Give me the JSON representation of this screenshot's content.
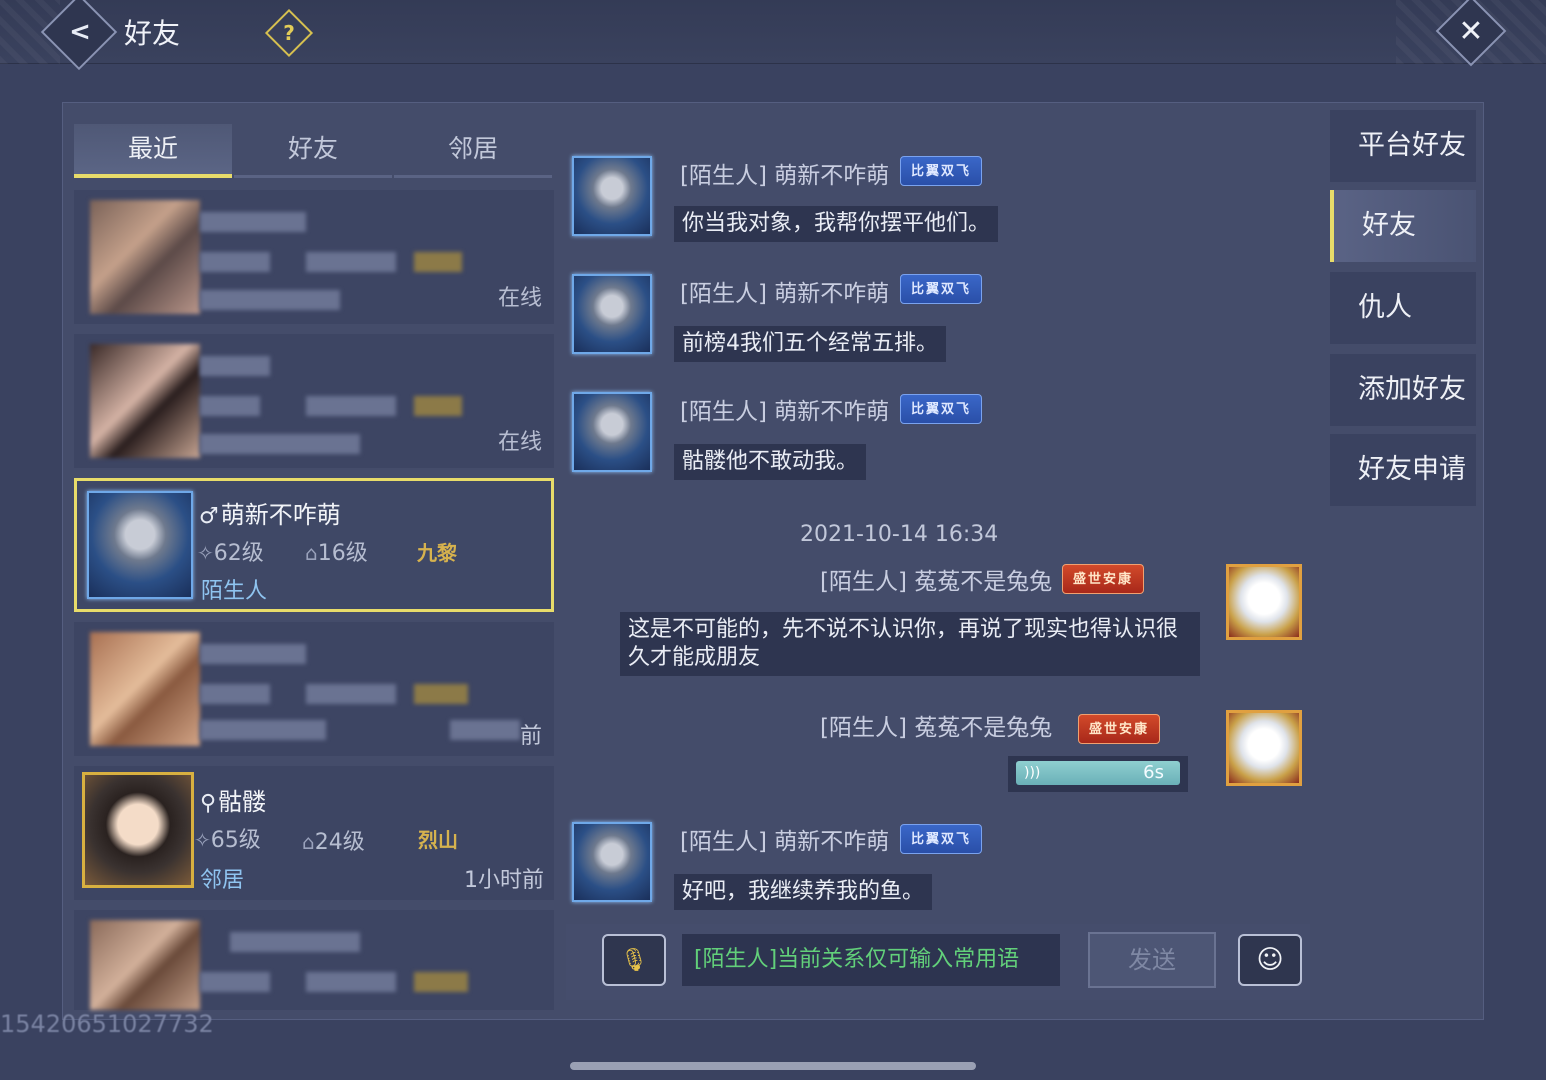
{
  "header": {
    "back_icon": "chevron-left-icon",
    "title": "好友",
    "help_icon": "?",
    "close_icon": "close-icon"
  },
  "tabs": [
    {
      "label": "最近",
      "active": true
    },
    {
      "label": "好友",
      "active": false
    },
    {
      "label": "邻居",
      "active": false
    }
  ],
  "friends": [
    {
      "status": "在线",
      "blurred": true
    },
    {
      "status": "在线",
      "blurred": true
    },
    {
      "name": "萌新不咋萌",
      "gender": "♂",
      "level": "62级",
      "level2": "16级",
      "guild": "九黎",
      "relation": "陌生人",
      "selected": true
    },
    {
      "time": "前",
      "blurred": true
    },
    {
      "name": "骷髅",
      "gender": "⚲",
      "level": "65级",
      "level2": "24级",
      "guild": "烈山",
      "relation": "邻居",
      "time": "1小时前"
    },
    {
      "blurred": true
    }
  ],
  "footer_id": "15420651027732",
  "chat": {
    "messages": [
      {
        "sender": "[陌生人] 萌新不咋萌",
        "badge": "比翼双飞",
        "text": "你当我对象，我帮你摆平他们。",
        "side": "left"
      },
      {
        "sender": "[陌生人] 萌新不咋萌",
        "badge": "比翼双飞",
        "text": "前榜4我们五个经常五排。",
        "side": "left"
      },
      {
        "sender": "[陌生人] 萌新不咋萌",
        "badge": "比翼双飞",
        "text": "骷髅他不敢动我。",
        "side": "left"
      },
      {
        "timestamp": "2021-10-14  16:34"
      },
      {
        "sender": "[陌生人] 菟菟不是兔兔",
        "badge": "盛世安康",
        "text_line1": "这是不可能的，先不说不认识你，再说了现实也得认识很",
        "text_line2": "久才能成朋友",
        "side": "right"
      },
      {
        "sender": "[陌生人] 菟菟不是兔兔",
        "badge": "盛世安康",
        "voice_duration": "6s",
        "side": "right"
      },
      {
        "sender": "[陌生人] 萌新不咋萌",
        "badge": "比翼双飞",
        "text": "好吧，我继续养我的鱼。",
        "side": "left"
      }
    ]
  },
  "input": {
    "mic_icon": "microphone-icon",
    "placeholder_prefix": "[陌生人]",
    "placeholder_text": "当前关系仅可输入常用语",
    "send_label": "发送",
    "emoji_icon": "emoji-icon"
  },
  "right_nav": [
    {
      "label": "平台好友",
      "active": false
    },
    {
      "label": "好友",
      "active": true
    },
    {
      "label": "仇人",
      "active": false
    },
    {
      "label": "添加好友",
      "active": false
    },
    {
      "label": "好友申请",
      "active": false
    }
  ]
}
